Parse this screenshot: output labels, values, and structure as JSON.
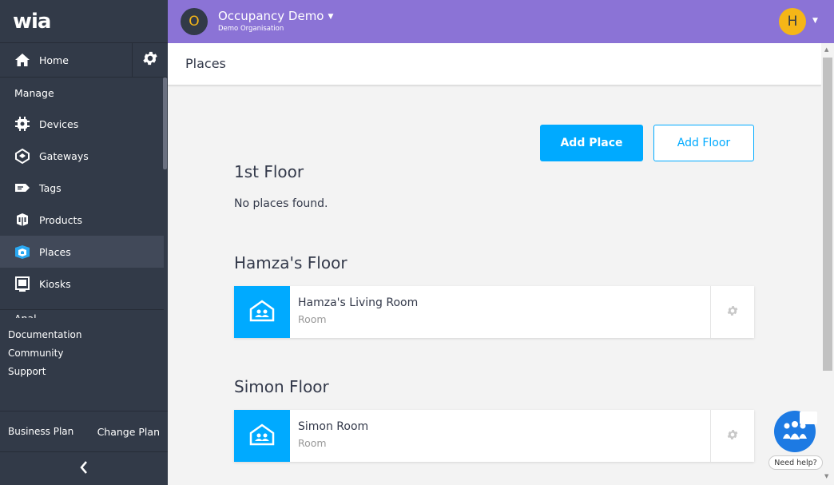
{
  "app": {
    "logo_text": "wia"
  },
  "colors": {
    "accent": "#00aaff",
    "topbar": "#8b73d6",
    "sidebar": "#323a48",
    "avatar_yellow": "#f5b617"
  },
  "sidebar": {
    "home_label": "Home",
    "manage_label": "Manage",
    "items": [
      {
        "label": "Devices",
        "icon": "devices-icon"
      },
      {
        "label": "Gateways",
        "icon": "gateways-icon"
      },
      {
        "label": "Tags",
        "icon": "tags-icon"
      },
      {
        "label": "Products",
        "icon": "products-icon"
      },
      {
        "label": "Places",
        "icon": "places-icon",
        "active": true
      },
      {
        "label": "Kiosks",
        "icon": "kiosks-icon"
      }
    ],
    "cut_off_label": "Anal",
    "links": [
      "Documentation",
      "Community",
      "Support"
    ],
    "plan_name": "Business Plan",
    "change_plan": "Change Plan"
  },
  "topbar": {
    "org_initial": "O",
    "org_name": "Occupancy Demo",
    "org_sub": "Demo Organisation",
    "user_initial": "H"
  },
  "page": {
    "title": "Places",
    "add_place": "Add Place",
    "add_floor": "Add Floor",
    "empty_message": "No places found."
  },
  "floors": [
    {
      "name": "1st Floor",
      "places": []
    },
    {
      "name": "Hamza's Floor",
      "places": [
        {
          "name": "Hamza's Living Room",
          "type": "Room"
        }
      ]
    },
    {
      "name": "Simon Floor",
      "places": [
        {
          "name": "Simon Room",
          "type": "Room"
        }
      ]
    }
  ],
  "help": {
    "label": "Need help?"
  }
}
